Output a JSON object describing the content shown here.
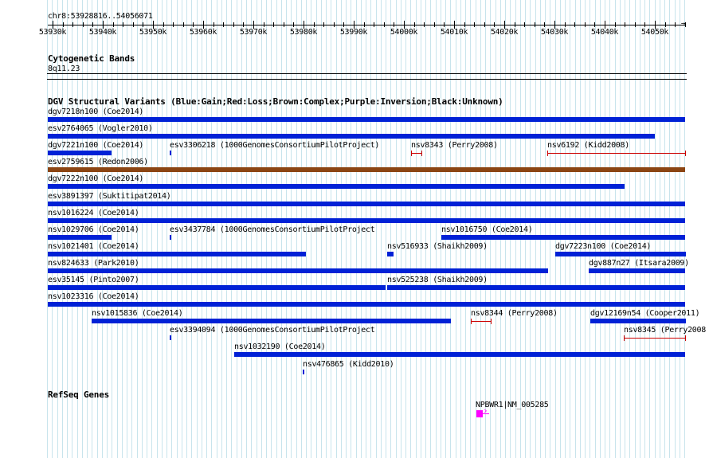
{
  "ruler": {
    "range_label": "chr8:53928816..54056071",
    "ticks": [
      "53930k",
      "53940k",
      "53950k",
      "53960k",
      "53970k",
      "53980k",
      "53990k",
      "54000k",
      "54010k",
      "54020k",
      "54030k",
      "54040k",
      "54050k"
    ]
  },
  "tracks": {
    "cytoband": {
      "title": "Cytogenetic Bands",
      "band": "8q11.23"
    },
    "dgv": {
      "title": "DGV Structural Variants (Blue:Gain;Red:Loss;Brown:Complex;Purple:Inversion;Black:Unknown)"
    },
    "refseq": {
      "title": "RefSeq Genes"
    }
  },
  "colors": {
    "gain": "#0021d6",
    "loss": "#cc0000",
    "complex": "#8b4513",
    "gene": "#ff00ff",
    "grid": "#c8e4ec"
  },
  "features": [
    {
      "label": "dgv7218n100 (Coe2014)",
      "start": 53928816,
      "end": 54056071,
      "type": "gain",
      "row": 0
    },
    {
      "label": "esv2764065 (Vogler2010)",
      "start": 53928816,
      "end": 54050000,
      "type": "gain",
      "row": 1
    },
    {
      "label": "dgv7221n100 (Coe2014)",
      "start": 53928816,
      "end": 53941800,
      "type": "gain",
      "row": 2
    },
    {
      "label": "esv3306218 (1000GenomesConsortiumPilotProject)",
      "start": 53953400,
      "end": 53953700,
      "type": "gain",
      "row": 2
    },
    {
      "label": "nsv8343 (Perry2008)",
      "start": 54001500,
      "end": 54003500,
      "type": "loss",
      "row": 2
    },
    {
      "label": "nsv6192 (Kidd2008)",
      "start": 54028500,
      "end": 54056071,
      "type": "loss",
      "row": 2
    },
    {
      "label": "esv2759615 (Redon2006)",
      "start": 53928816,
      "end": 54056071,
      "type": "complex",
      "row": 3
    },
    {
      "label": "dgv7222n100 (Coe2014)",
      "start": 53928816,
      "end": 54044000,
      "type": "gain",
      "row": 4
    },
    {
      "label": "esv3891397 (Suktitipat2014)",
      "start": 53928816,
      "end": 54056071,
      "type": "gain",
      "row": 5
    },
    {
      "label": "nsv1016224 (Coe2014)",
      "start": 53928816,
      "end": 54056071,
      "type": "gain",
      "row": 6
    },
    {
      "label": "nsv1029706 (Coe2014)",
      "start": 53928816,
      "end": 53941800,
      "type": "gain",
      "row": 7
    },
    {
      "label": "esv3437784 (1000GenomesConsortiumPilotProject",
      "start": 53953400,
      "end": 53953700,
      "type": "gain",
      "row": 7
    },
    {
      "label": "nsv1016750 (Coe2014)",
      "start": 54007500,
      "end": 54056071,
      "type": "gain",
      "row": 7
    },
    {
      "label": "nsv1021401 (Coe2014)",
      "start": 53928816,
      "end": 53980400,
      "type": "gain",
      "row": 8
    },
    {
      "label": "nsv516933 (Shaikh2009)",
      "start": 53996700,
      "end": 53997900,
      "type": "gain",
      "row": 8
    },
    {
      "label": "dgv7223n100 (Coe2014)",
      "start": 54030100,
      "end": 54056071,
      "type": "gain",
      "row": 8
    },
    {
      "label": "nsv824633 (Park2010)",
      "start": 53928816,
      "end": 54028700,
      "type": "gain",
      "row": 9
    },
    {
      "label": "dgv887n27 (Itsara2009)",
      "start": 54036900,
      "end": 54056071,
      "type": "gain",
      "row": 9
    },
    {
      "label": "esv35145 (Pinto2007)",
      "start": 53928816,
      "end": 53996400,
      "type": "gain",
      "row": 10
    },
    {
      "label": "nsv525238 (Shaikh2009)",
      "start": 53996700,
      "end": 54056071,
      "type": "gain",
      "row": 10
    },
    {
      "label": "nsv1023316 (Coe2014)",
      "start": 53928816,
      "end": 54056071,
      "type": "gain",
      "row": 11
    },
    {
      "label": "nsv1015836 (Coe2014)",
      "start": 53937800,
      "end": 54009400,
      "type": "gain",
      "row": 12
    },
    {
      "label": "nsv8344 (Perry2008)",
      "start": 54013300,
      "end": 54017300,
      "type": "loss",
      "row": 12
    },
    {
      "label": "dgv12169n54 (Cooper2011)",
      "start": 54037100,
      "end": 54056071,
      "type": "gain",
      "row": 12
    },
    {
      "label": "esv3394094 (1000GenomesConsortiumPilotProject",
      "start": 53953400,
      "end": 53953700,
      "type": "gain",
      "row": 13
    },
    {
      "label": "nsv8345 (Perry2008",
      "start": 54043800,
      "end": 54056071,
      "type": "loss",
      "row": 13
    },
    {
      "label": "nsv1032190 (Coe2014)",
      "start": 53966200,
      "end": 54056071,
      "type": "gain",
      "row": 14
    },
    {
      "label": "nsv476865 (Kidd2010)",
      "start": 53979900,
      "end": 53980300,
      "type": "gain",
      "row": 15
    }
  ],
  "genes": [
    {
      "label": "NPBWR1|NM_005285",
      "start": 54014500,
      "end": 54017400,
      "strand": "+"
    }
  ]
}
